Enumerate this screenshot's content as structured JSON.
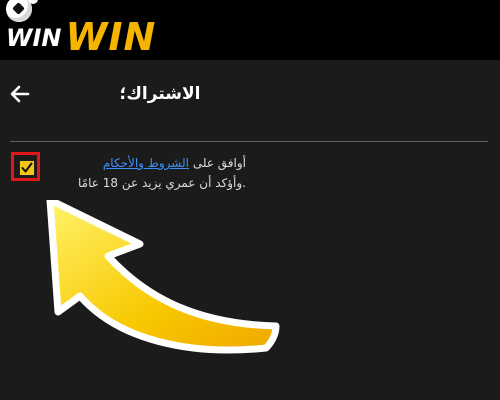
{
  "header": {
    "logo_text_left": "WIN",
    "logo_text_right": "WIN"
  },
  "page": {
    "title": "الاشتراك؛"
  },
  "agreement": {
    "line1_prefix": "أوافق على",
    "terms_link": "الشروط والأحكام",
    "line2": ".وأؤكد أن عمري يزيد عن 18 عامًا",
    "checked": true
  },
  "colors": {
    "background": "#1b1b1b",
    "header": "#000000",
    "brand_yellow": "#f5b400",
    "checkbox_fill": "#f5c518",
    "highlight_red": "#e11818",
    "link_blue": "#3f8ef5"
  },
  "icons": {
    "back": "arrow-left-icon",
    "check": "check-icon",
    "pointer": "curved-arrow-icon"
  }
}
